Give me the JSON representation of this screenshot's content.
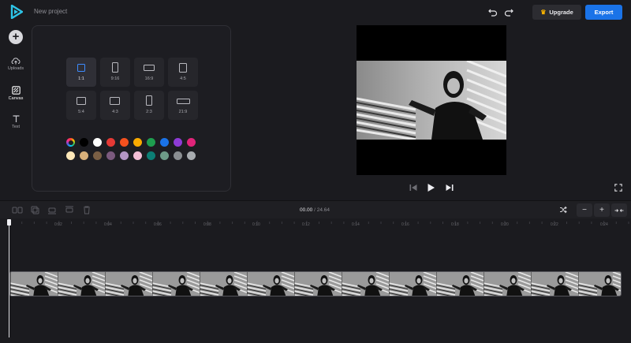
{
  "header": {
    "project_name": "New project",
    "upgrade_label": "Upgrade",
    "export_label": "Export"
  },
  "sidebar": {
    "items": [
      {
        "label": "Uploads",
        "icon": "upload-cloud-icon"
      },
      {
        "label": "Canvas",
        "icon": "canvas-icon"
      },
      {
        "label": "Text",
        "icon": "text-icon"
      }
    ]
  },
  "canvas_panel": {
    "ratios": [
      "1:1",
      "9:16",
      "16:9",
      "4:5",
      "5:4",
      "4:3",
      "2:3",
      "21:9"
    ],
    "selected_ratio": "1:1",
    "colors_row1": [
      "#000000",
      "#ffffff",
      "#e53935",
      "#f4511e",
      "#f9ab00",
      "#1e9e4f",
      "#1a73e8",
      "#8e3bd6",
      "#e0247a"
    ],
    "colors_row2": [
      "#fde7b8",
      "#d8b07a",
      "#7a5f45",
      "#7b5a7e",
      "#b496c4",
      "#f4bed6",
      "#0c7e74",
      "#6e9b88",
      "#8a8e92",
      "#a8acb0"
    ]
  },
  "timeline": {
    "current_time": "00.00",
    "separator": "/",
    "total_time": "24.64",
    "ticks": [
      "0:02",
      "0:04",
      "0:06",
      "0:08",
      "0:10",
      "0:12",
      "0:14",
      "0:16",
      "0:18",
      "0:20",
      "0:22",
      "0:24"
    ]
  }
}
